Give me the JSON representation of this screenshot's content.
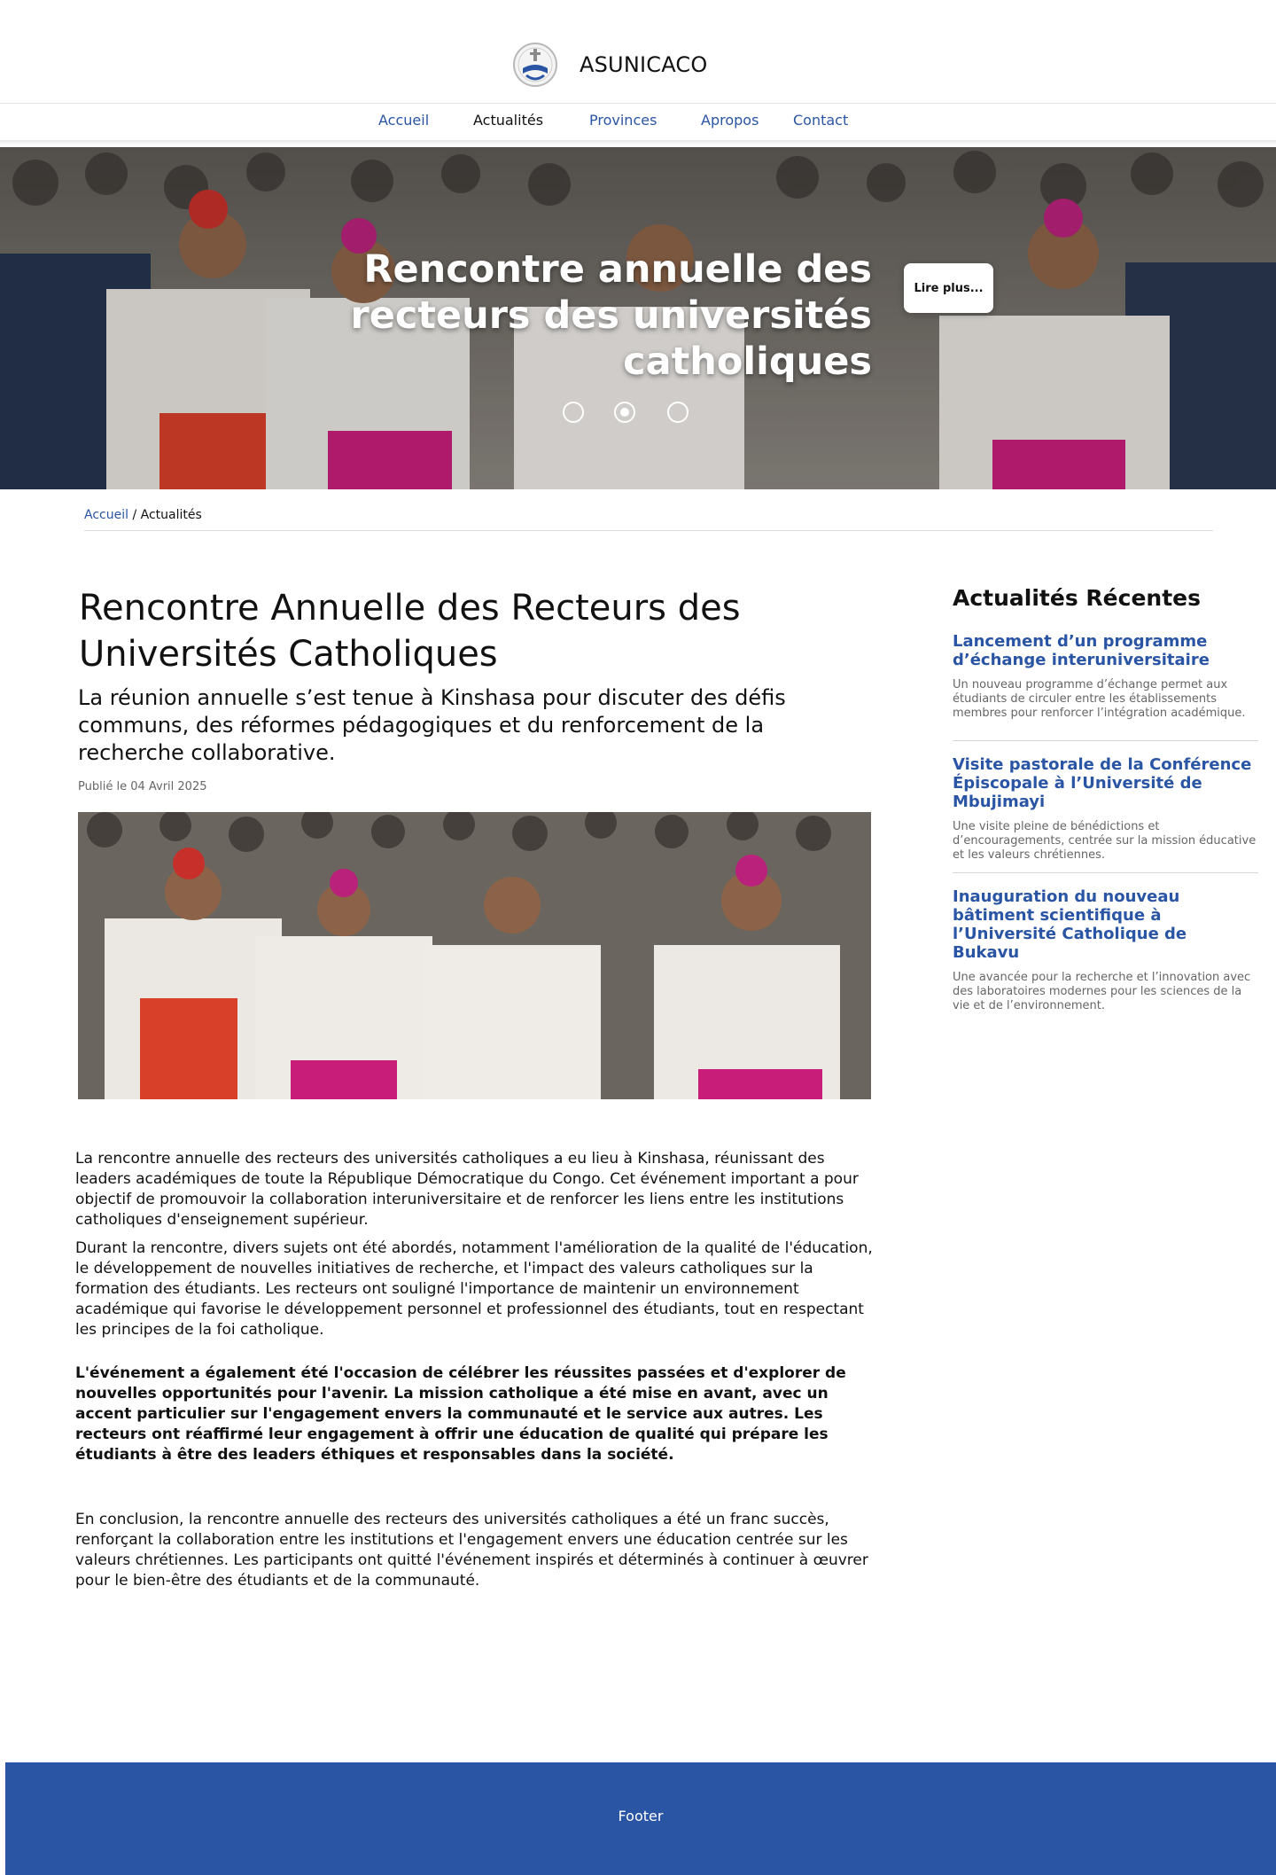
{
  "brand": {
    "name": "ASUNICACO",
    "logo_icon": "university-crest-icon"
  },
  "nav": {
    "items": [
      {
        "label": "Accueil",
        "active": false
      },
      {
        "label": "Actualités",
        "active": true
      },
      {
        "label": "Provinces",
        "active": false
      },
      {
        "label": "Apropos",
        "active": false
      },
      {
        "label": "Contact",
        "active": false
      }
    ]
  },
  "hero": {
    "title": "Rencontre annuelle des recteurs des universités catholiques",
    "button_label": "Lire plus...",
    "slides_count": 3,
    "active_slide": 2
  },
  "breadcrumb": {
    "home": "Accueil",
    "separator": "/",
    "current": "Actualités"
  },
  "article": {
    "title": "Rencontre Annuelle des Recteurs des Universités Catholiques",
    "lead": "La réunion annuelle s’est tenue à Kinshasa pour discuter des défis communs, des réformes pédagogiques et du renforcement de la recherche collaborative.",
    "date": "Publié le 04 Avril 2025",
    "paragraphs": [
      "La rencontre annuelle des recteurs des universités catholiques a eu lieu à Kinshasa, réunissant des leaders académiques de toute la République Démocratique du Congo. Cet événement important a pour objectif de promouvoir la collaboration interuniversitaire et de renforcer les liens entre les institutions catholiques d'enseignement supérieur.",
      "Durant la rencontre, divers sujets ont été abordés, notamment l'amélioration de la qualité de l'éducation, le développement de nouvelles initiatives de recherche, et l'impact des valeurs catholiques sur la formation des étudiants. Les recteurs ont souligné l'importance de maintenir un environnement académique qui favorise le développement personnel et professionnel des étudiants, tout en respectant les principes de la foi catholique.",
      "L'événement a également été l'occasion de célébrer les réussites passées et d'explorer de nouvelles opportunités pour l'avenir. La mission catholique a été mise en avant, avec un accent particulier sur l'engagement envers la communauté et le service aux autres. Les recteurs ont réaffirmé leur engagement à offrir une éducation de qualité qui prépare les étudiants à être des leaders éthiques et responsables dans la société.",
      "En conclusion, la rencontre annuelle des recteurs des universités catholiques a été un franc succès, renforçant la collaboration entre les institutions et l'engagement envers une éducation centrée sur les valeurs chrétiennes. Les participants ont quitté l'événement inspirés et déterminés à continuer à œuvrer pour le bien-être des étudiants et de la communauté."
    ]
  },
  "sidebar": {
    "title": "Actualités Récentes",
    "items": [
      {
        "title": "Lancement d’un programme d’échange interuniversitaire",
        "excerpt": "Un nouveau programme d’échange permet aux étudiants de circuler entre les établissements membres pour renforcer l’intégration académique."
      },
      {
        "title": "Visite pastorale de la Conférence Épiscopale à l’Université de Mbujimayi",
        "excerpt": "Une visite pleine de bénédictions et d’encouragements, centrée sur la mission éducative et les valeurs chrétiennes."
      },
      {
        "title": "Inauguration du nouveau bâtiment scientifique à l’Université Catholique de Bukavu",
        "excerpt": "Une avancée pour la recherche et l’innovation avec des laboratoires modernes pour les sciences de la vie et de l’environnement."
      }
    ]
  },
  "footer": {
    "label": "Footer"
  },
  "colors": {
    "accent": "#2a55a4",
    "text": "#111111",
    "muted": "#666666"
  }
}
